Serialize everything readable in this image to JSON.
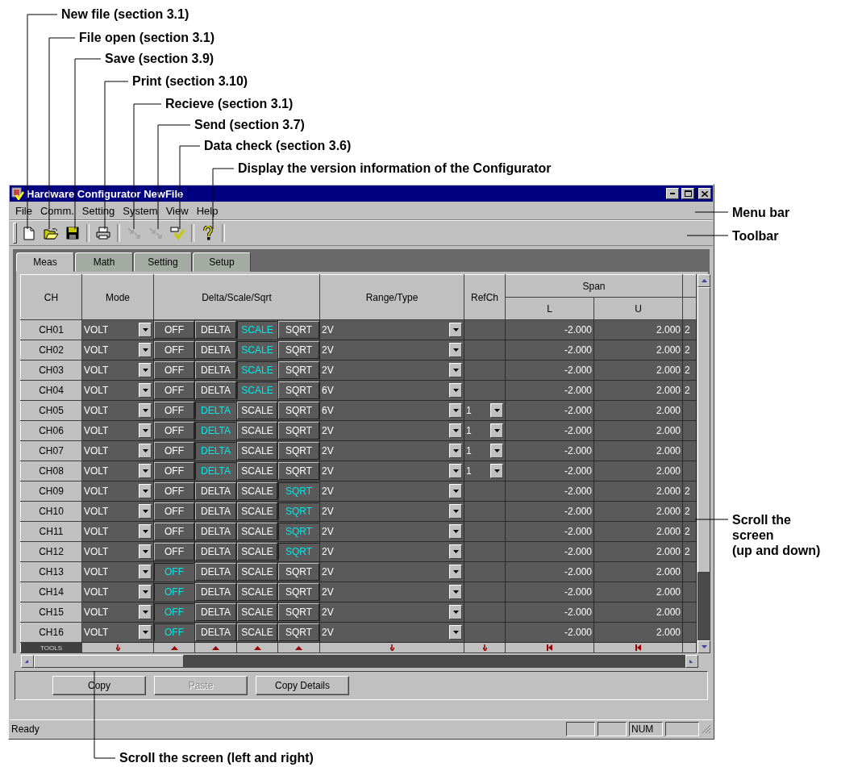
{
  "callouts": [
    {
      "text": "New file (section 3.1)"
    },
    {
      "text": "File open (section 3.1)"
    },
    {
      "text": "Save (section 3.9)"
    },
    {
      "text": "Print (section 3.10)"
    },
    {
      "text": "Recieve (section 3.1)"
    },
    {
      "text": "Send (section 3.7)"
    },
    {
      "text": "Data check (section 3.6)"
    },
    {
      "text": "Display the version information of the Configurator"
    }
  ],
  "side_labels": [
    {
      "lines": [
        "Menu bar"
      ]
    },
    {
      "lines": [
        "Toolbar"
      ]
    },
    {
      "lines": [
        "Scroll the",
        "screen",
        "(up and down)"
      ]
    }
  ],
  "bottom_label": "Scroll the screen (left and right)",
  "window": {
    "title": "Hardware Configurator NewFile"
  },
  "menu": [
    "File",
    "Comm.",
    "Setting",
    "System",
    "View",
    "Help"
  ],
  "toolbar": [
    {
      "kind": "new",
      "disabled": false
    },
    {
      "kind": "open",
      "disabled": false
    },
    {
      "kind": "save",
      "disabled": false
    },
    {
      "kind": "print",
      "disabled": false
    },
    {
      "kind": "receive",
      "disabled": true
    },
    {
      "kind": "send",
      "disabled": true
    },
    {
      "kind": "check",
      "disabled": false
    },
    {
      "kind": "help",
      "disabled": false
    }
  ],
  "tabs": [
    {
      "label": "Meas",
      "selected": true
    },
    {
      "label": "Math",
      "selected": false
    },
    {
      "label": "Setting",
      "selected": false
    },
    {
      "label": "Setup",
      "selected": false
    }
  ],
  "table": {
    "columns": {
      "ch": "CH",
      "mode": "Mode",
      "dss": "Delta/Scale/Sqrt",
      "range": "Range/Type",
      "refch": "RefCh",
      "span": "Span",
      "l": "L",
      "u": "U"
    },
    "rows": [
      {
        "ch": "CH01",
        "mode": "VOLT",
        "options": [
          {
            "label": "OFF",
            "selected": false
          },
          {
            "label": "DELTA",
            "selected": false
          },
          {
            "label": "SCALE",
            "selected": true
          },
          {
            "label": "SQRT",
            "selected": false
          }
        ],
        "range": "2V",
        "l": "-2.000",
        "u": "2.000",
        "extra": "2"
      },
      {
        "ch": "CH02",
        "mode": "VOLT",
        "options": [
          {
            "label": "OFF",
            "selected": false
          },
          {
            "label": "DELTA",
            "selected": false
          },
          {
            "label": "SCALE",
            "selected": true
          },
          {
            "label": "SQRT",
            "selected": false
          }
        ],
        "range": "2V",
        "l": "-2.000",
        "u": "2.000",
        "extra": "2"
      },
      {
        "ch": "CH03",
        "mode": "VOLT",
        "options": [
          {
            "label": "OFF",
            "selected": false
          },
          {
            "label": "DELTA",
            "selected": false
          },
          {
            "label": "SCALE",
            "selected": true
          },
          {
            "label": "SQRT",
            "selected": false
          }
        ],
        "range": "2V",
        "l": "-2.000",
        "u": "2.000",
        "extra": "2"
      },
      {
        "ch": "CH04",
        "mode": "VOLT",
        "options": [
          {
            "label": "OFF",
            "selected": false
          },
          {
            "label": "DELTA",
            "selected": false
          },
          {
            "label": "SCALE",
            "selected": true
          },
          {
            "label": "SQRT",
            "selected": false
          }
        ],
        "range": "6V",
        "l": "-2.000",
        "u": "2.000",
        "extra": "2"
      },
      {
        "ch": "CH05",
        "mode": "VOLT",
        "options": [
          {
            "label": "OFF",
            "selected": false
          },
          {
            "label": "DELTA",
            "selected": true
          },
          {
            "label": "SCALE",
            "selected": false
          },
          {
            "label": "SQRT",
            "selected": false
          }
        ],
        "range": "6V",
        "refch": "1",
        "l": "-2.000",
        "u": "2.000"
      },
      {
        "ch": "CH06",
        "mode": "VOLT",
        "options": [
          {
            "label": "OFF",
            "selected": false
          },
          {
            "label": "DELTA",
            "selected": true
          },
          {
            "label": "SCALE",
            "selected": false
          },
          {
            "label": "SQRT",
            "selected": false
          }
        ],
        "range": "2V",
        "refch": "1",
        "l": "-2.000",
        "u": "2.000"
      },
      {
        "ch": "CH07",
        "mode": "VOLT",
        "options": [
          {
            "label": "OFF",
            "selected": false
          },
          {
            "label": "DELTA",
            "selected": true
          },
          {
            "label": "SCALE",
            "selected": false
          },
          {
            "label": "SQRT",
            "selected": false
          }
        ],
        "range": "2V",
        "refch": "1",
        "l": "-2.000",
        "u": "2.000"
      },
      {
        "ch": "CH08",
        "mode": "VOLT",
        "options": [
          {
            "label": "OFF",
            "selected": false
          },
          {
            "label": "DELTA",
            "selected": true
          },
          {
            "label": "SCALE",
            "selected": false
          },
          {
            "label": "SQRT",
            "selected": false
          }
        ],
        "range": "2V",
        "refch": "1",
        "l": "-2.000",
        "u": "2.000"
      },
      {
        "ch": "CH09",
        "mode": "VOLT",
        "options": [
          {
            "label": "OFF",
            "selected": false
          },
          {
            "label": "DELTA",
            "selected": false
          },
          {
            "label": "SCALE",
            "selected": false
          },
          {
            "label": "SQRT",
            "selected": true
          }
        ],
        "range": "2V",
        "l": "-2.000",
        "u": "2.000",
        "extra": "2"
      },
      {
        "ch": "CH10",
        "mode": "VOLT",
        "options": [
          {
            "label": "OFF",
            "selected": false
          },
          {
            "label": "DELTA",
            "selected": false
          },
          {
            "label": "SCALE",
            "selected": false
          },
          {
            "label": "SQRT",
            "selected": true
          }
        ],
        "range": "2V",
        "l": "-2.000",
        "u": "2.000",
        "extra": "2"
      },
      {
        "ch": "CH11",
        "mode": "VOLT",
        "options": [
          {
            "label": "OFF",
            "selected": false
          },
          {
            "label": "DELTA",
            "selected": false
          },
          {
            "label": "SCALE",
            "selected": false
          },
          {
            "label": "SQRT",
            "selected": true
          }
        ],
        "range": "2V",
        "l": "-2.000",
        "u": "2.000",
        "extra": "2"
      },
      {
        "ch": "CH12",
        "mode": "VOLT",
        "options": [
          {
            "label": "OFF",
            "selected": false
          },
          {
            "label": "DELTA",
            "selected": false
          },
          {
            "label": "SCALE",
            "selected": false
          },
          {
            "label": "SQRT",
            "selected": true
          }
        ],
        "range": "2V",
        "l": "-2.000",
        "u": "2.000",
        "extra": "2"
      },
      {
        "ch": "CH13",
        "mode": "VOLT",
        "options": [
          {
            "label": "OFF",
            "selected": true
          },
          {
            "label": "DELTA",
            "selected": false
          },
          {
            "label": "SCALE",
            "selected": false
          },
          {
            "label": "SQRT",
            "selected": false
          }
        ],
        "range": "2V",
        "l": "-2.000",
        "u": "2.000"
      },
      {
        "ch": "CH14",
        "mode": "VOLT",
        "options": [
          {
            "label": "OFF",
            "selected": true
          },
          {
            "label": "DELTA",
            "selected": false
          },
          {
            "label": "SCALE",
            "selected": false
          },
          {
            "label": "SQRT",
            "selected": false
          }
        ],
        "range": "2V",
        "l": "-2.000",
        "u": "2.000"
      },
      {
        "ch": "CH15",
        "mode": "VOLT",
        "options": [
          {
            "label": "OFF",
            "selected": true
          },
          {
            "label": "DELTA",
            "selected": false
          },
          {
            "label": "SCALE",
            "selected": false
          },
          {
            "label": "SQRT",
            "selected": false
          }
        ],
        "range": "2V",
        "l": "-2.000",
        "u": "2.000"
      },
      {
        "ch": "CH16",
        "mode": "VOLT",
        "options": [
          {
            "label": "OFF",
            "selected": true
          },
          {
            "label": "DELTA",
            "selected": false
          },
          {
            "label": "SCALE",
            "selected": false
          },
          {
            "label": "SQRT",
            "selected": false
          }
        ],
        "range": "2V",
        "l": "-2.000",
        "u": "2.000"
      }
    ],
    "tools_label": "TOOLS"
  },
  "buttons": [
    {
      "label": "Copy",
      "disabled": false
    },
    {
      "label": "Paste",
      "disabled": true
    },
    {
      "label": "Copy Details",
      "disabled": false
    }
  ],
  "status_bar": {
    "text": "Ready",
    "panes": [
      "NUM"
    ]
  }
}
